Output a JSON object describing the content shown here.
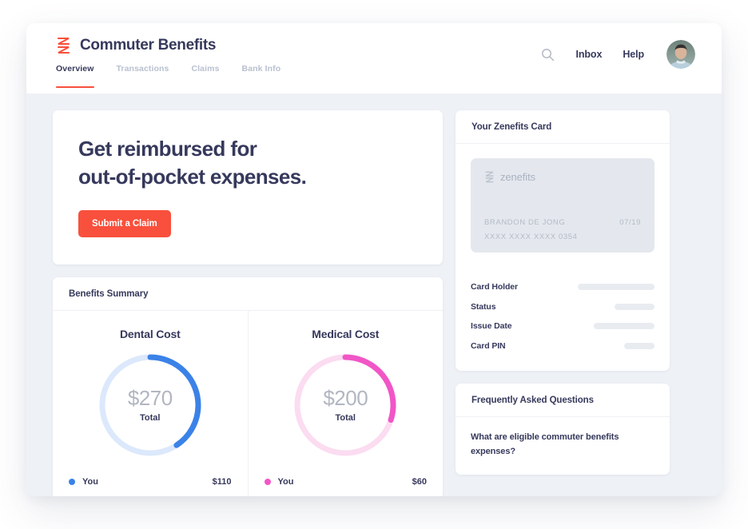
{
  "header": {
    "brand": "Commuter Benefits",
    "logo_icon": "zenefits-z-icon",
    "search_icon": "search-icon",
    "inbox_label": "Inbox",
    "help_label": "Help",
    "avatar_icon": "user-avatar",
    "accent_color": "#f8503c",
    "text_color": "#36395c"
  },
  "tabs": [
    {
      "label": "Overview",
      "active": true
    },
    {
      "label": "Transactions",
      "active": false
    },
    {
      "label": "Claims",
      "active": false
    },
    {
      "label": "Bank Info",
      "active": false
    }
  ],
  "hero": {
    "title_line1": "Get reimbursed for",
    "title_line2": "out-of-pocket expenses.",
    "cta_label": "Submit a Claim"
  },
  "benefits_summary": {
    "title": "Benefits Summary"
  },
  "chart_data": [
    {
      "type": "pie",
      "title": "Dental Cost",
      "center_value": "$270",
      "center_label": "Total",
      "total": 270,
      "legend_position": "bottom",
      "series": [
        {
          "name": "You",
          "value": 110,
          "display": "$110",
          "color": "#3b82e8"
        },
        {
          "name": "Remaining",
          "value": 160,
          "display": "",
          "color": "#dce8fb"
        }
      ]
    },
    {
      "type": "pie",
      "title": "Medical Cost",
      "center_value": "$200",
      "center_label": "Total",
      "total": 200,
      "legend_position": "bottom",
      "series": [
        {
          "name": "You",
          "value": 60,
          "display": "$60",
          "color": "#f156c6"
        },
        {
          "name": "Remaining",
          "value": 140,
          "display": "",
          "color": "#fbdcf1"
        }
      ]
    }
  ],
  "zenefits_card": {
    "panel_title": "Your Zenefits Card",
    "brand_text": "zenefits",
    "brand_icon": "zenefits-z-icon",
    "holder_name": "BRANDON DE JONG",
    "expiry": "07/19",
    "number": "XXXX XXXX XXXX 0354",
    "details": [
      {
        "label": "Card Holder",
        "skeleton_width": 96
      },
      {
        "label": "Status",
        "skeleton_width": 50
      },
      {
        "label": "Issue Date",
        "skeleton_width": 76
      },
      {
        "label": "Card PIN",
        "skeleton_width": 38
      }
    ]
  },
  "faq": {
    "panel_title": "Frequently Asked Questions",
    "questions": [
      "What are eligible commuter benefits expenses?"
    ]
  }
}
